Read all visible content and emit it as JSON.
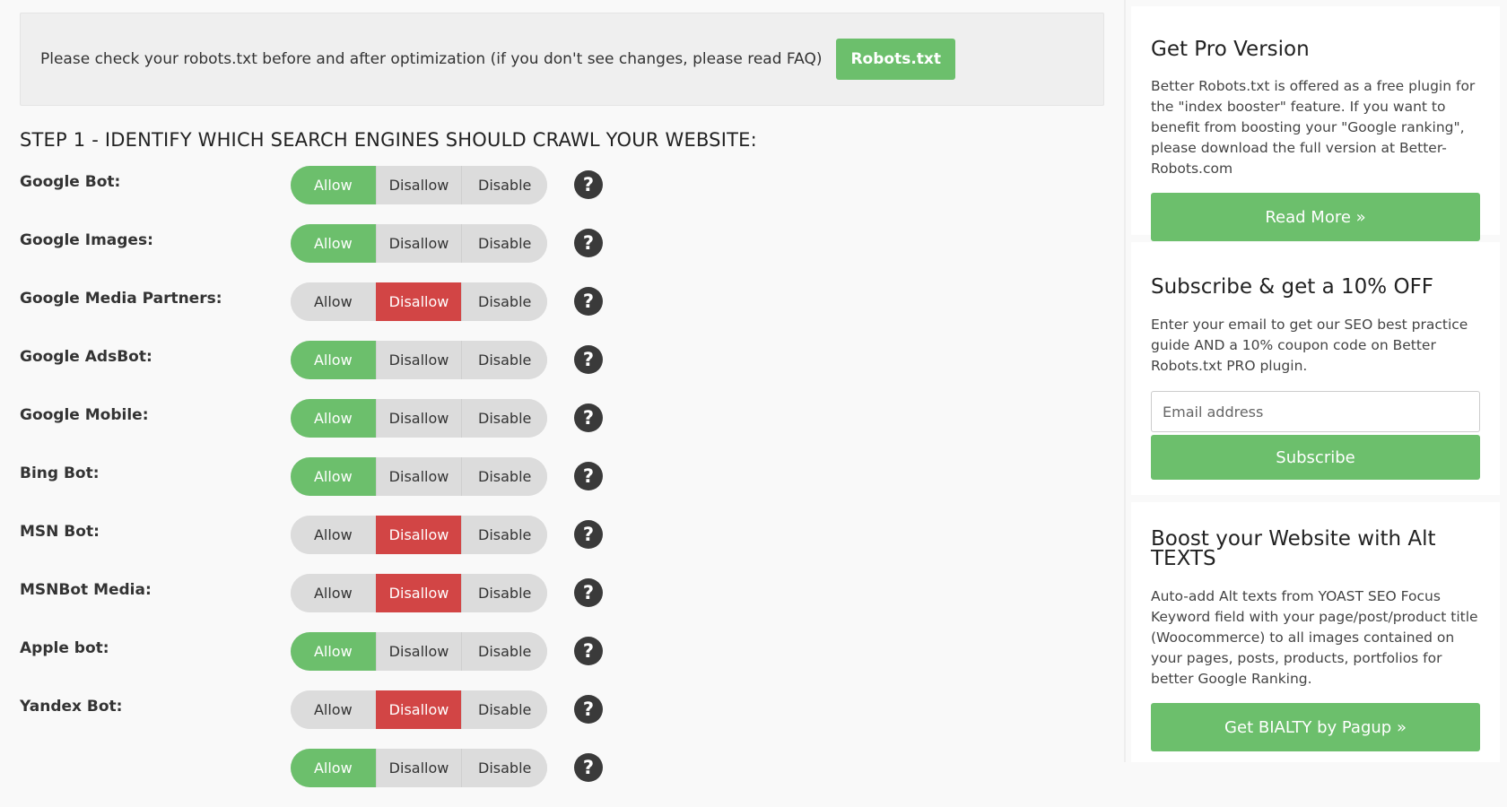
{
  "notice": {
    "text": "Please check your robots.txt before and after optimization (if you don't see changes, please read FAQ)",
    "button_label": "Robots.txt"
  },
  "step1": {
    "heading": "STEP 1 - IDENTIFY WHICH SEARCH ENGINES SHOULD CRAWL YOUR WEBSITE:",
    "options": [
      "Allow",
      "Disallow",
      "Disable"
    ],
    "help_symbol": "?",
    "bots": [
      {
        "label": "Google Bot:",
        "selected": "Allow"
      },
      {
        "label": "Google Images:",
        "selected": "Allow"
      },
      {
        "label": "Google Media Partners:",
        "selected": "Disallow"
      },
      {
        "label": "Google AdsBot:",
        "selected": "Allow"
      },
      {
        "label": "Google Mobile:",
        "selected": "Allow"
      },
      {
        "label": "Bing Bot:",
        "selected": "Allow"
      },
      {
        "label": "MSN Bot:",
        "selected": "Disallow"
      },
      {
        "label": "MSNBot Media:",
        "selected": "Disallow"
      },
      {
        "label": "Apple bot:",
        "selected": "Allow"
      },
      {
        "label": "Yandex Bot:",
        "selected": "Disallow"
      },
      {
        "label": "",
        "selected": "Allow"
      }
    ]
  },
  "sidebar": {
    "pro": {
      "title": "Get Pro Version",
      "text": "Better Robots.txt is offered as a free plugin for the \"index booster\" feature. If you want to benefit from boosting your \"Google ranking\", please download the full version at Better-Robots.com",
      "button_label": "Read More »"
    },
    "subscribe": {
      "title": "Subscribe & get a 10% OFF",
      "text": "Enter your email to get our SEO best practice guide AND a 10% coupon code on Better Robots.txt PRO plugin.",
      "email_placeholder": "Email address",
      "button_label": "Subscribe"
    },
    "boost": {
      "title": "Boost your Website with Alt TEXTS",
      "text": "Auto-add Alt texts from YOAST SEO Focus Keyword field with your page/post/product title (Woocommerce) to all images contained on your pages, posts, products, portfolios for better Google Ranking.",
      "button_label": "Get BIALTY by Pagup »"
    }
  },
  "colors": {
    "green": "#6cbf6c",
    "red": "#d24545",
    "toggle_gray": "#dcdcdc",
    "help_dark": "#3a3a3a"
  }
}
